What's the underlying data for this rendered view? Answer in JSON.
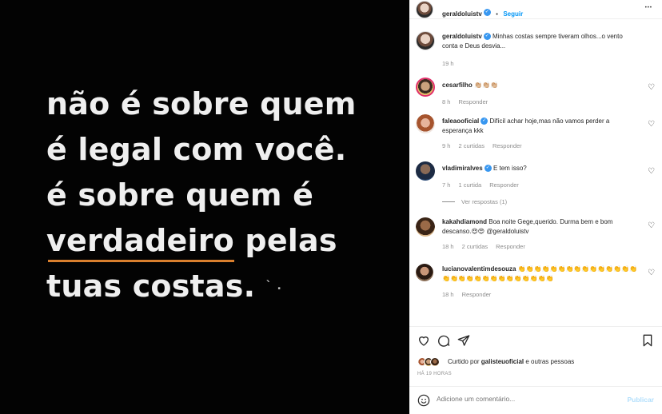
{
  "post": {
    "quote_lines": [
      "não é sobre quem",
      "é legal com você.",
      "é sobre quem é"
    ],
    "quote_highlight": "verdadeiro",
    "quote_line4_rest": " pelas",
    "quote_line5": "tuas costas.",
    "quote_dots": "` ."
  },
  "header": {
    "username": "geraldoluistv",
    "dot": "•",
    "follow_label": "Seguir",
    "more_icon": "more-horizontal-icon",
    "more_glyph": "•••"
  },
  "caption": {
    "username": "geraldoluistv",
    "text": "Minhas costas sempre tiveram olhos...o vento conta e Deus desvia...",
    "time": "19 h"
  },
  "comments": [
    {
      "username": "cesarfilho",
      "text": "👏🏼👏🏼👏🏼",
      "time": "8 h",
      "likes": "",
      "reply": "Responder",
      "verified": false
    },
    {
      "username": "faleaooficial",
      "text": "Difícil achar hoje,mas não vamos perder a esperança kkk",
      "time": "9 h",
      "likes": "2 curtidas",
      "reply": "Responder",
      "verified": true
    },
    {
      "username": "vladimiralves",
      "text": "E tem isso?",
      "time": "7 h",
      "likes": "1 curtida",
      "reply": "Responder",
      "verified": true,
      "view_replies": "Ver respostas (1)"
    },
    {
      "username": "kakahdiamond",
      "text": "Boa noite Gege,querido. Durma bem e bom descanso.😍😍 @geraldoluistv",
      "time": "18 h",
      "likes": "2 curtidas",
      "reply": "Responder",
      "verified": false
    },
    {
      "username": "lucianovalentimdesouza",
      "text": "👏👏👏👏👏👏👏👏👏👏👏👏👏👏👏👏👏👏👏👏👏👏👏👏👏👏👏👏👏",
      "time": "18 h",
      "likes": "",
      "reply": "Responder",
      "verified": false
    }
  ],
  "actions": {
    "like_icon": "heart-icon",
    "comment_icon": "comment-icon",
    "share_icon": "paper-plane-icon",
    "save_icon": "bookmark-icon"
  },
  "liked_by": {
    "prefix": "Curtido por ",
    "user": "galisteuoficial",
    "suffix": " e outras pessoas"
  },
  "timestamp": "HÁ 19 HORAS",
  "add_comment": {
    "emoji_icon": "smiley-icon",
    "placeholder": "Adicione um comentário...",
    "publish_label": "Publicar"
  },
  "colors": {
    "accent": "#0095f6",
    "verified": "#3897f0",
    "underline": "#d97f2e",
    "muted": "#8e8e8e"
  }
}
